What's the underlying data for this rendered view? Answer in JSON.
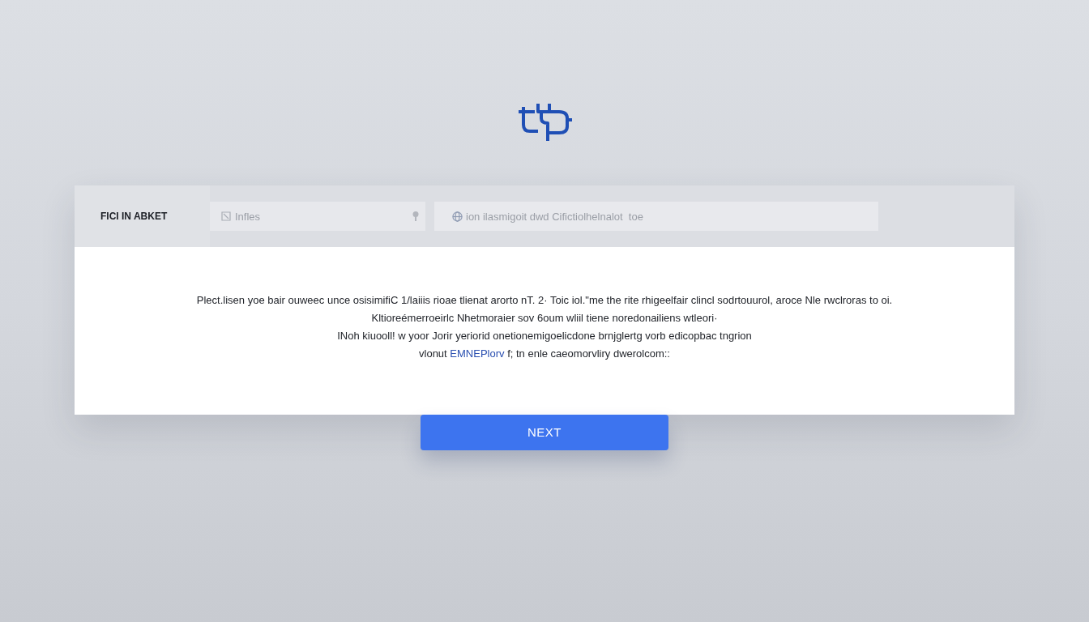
{
  "header": {
    "label": "FICI IN ABKET",
    "fields": [
      {
        "kind": "file",
        "placeholder": "Infles"
      },
      {
        "kind": "web",
        "placeholder": "ion ilasmigoit dwd Cifictiolhelnalot  toe"
      }
    ]
  },
  "body": {
    "lines": [
      "Plect.lisen yoe bair ouweec unce osisimifiC 1/laiiis rioae tlienat arorto nT. 2· Toic iol.\"me the rite rhigeelfair clincl sodrtouurol, aroce Nle rwclroras to oi.",
      "Kltioreémerroeirlc Nhetmoraier sov 6oum wliil tiene noredonailiens wtleori·",
      "INoh kiuooll! w yoor Jorir yeriorid onetionemigoelicdone brnjglertg vorb  edicopbac tngrion"
    ],
    "link_line": {
      "before": "vlonut",
      "link": "EMNEPlorv",
      "after": "f; tn enle caeomorvliry dwerolcom::"
    }
  },
  "button": {
    "label": "NEXT"
  }
}
